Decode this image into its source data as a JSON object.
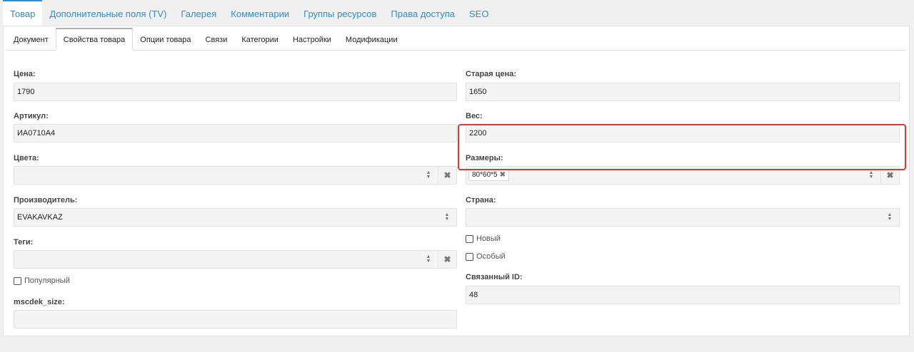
{
  "top_tabs": [
    "Товар",
    "Дополнительные поля (TV)",
    "Галерея",
    "Комментарии",
    "Группы ресурсов",
    "Права доступа",
    "SEO"
  ],
  "sub_tabs": [
    "Документ",
    "Свойства товара",
    "Опции товара",
    "Связи",
    "Категории",
    "Настройки",
    "Модификации"
  ],
  "left": {
    "price": {
      "label": "Цена:",
      "value": "1790"
    },
    "article": {
      "label": "Артикул:",
      "value": "ИА0710А4"
    },
    "colors": {
      "label": "Цвета:",
      "value": ""
    },
    "manufacturer": {
      "label": "Производитель:",
      "value": "EVAKAVKAZ"
    },
    "tags": {
      "label": "Теги:",
      "value": ""
    },
    "popular": {
      "label": "Популярный",
      "checked": false
    },
    "mscdek": {
      "label": "mscdek_size:",
      "value": ""
    }
  },
  "right": {
    "old_price": {
      "label": "Старая цена:",
      "value": "1650"
    },
    "weight": {
      "label": "Вес:",
      "value": "2200"
    },
    "sizes": {
      "label": "Размеры:",
      "tags": [
        "80*60*5"
      ]
    },
    "country": {
      "label": "Страна:",
      "value": ""
    },
    "new": {
      "label": "Новый",
      "checked": false
    },
    "special": {
      "label": "Особый",
      "checked": false
    },
    "linked_id": {
      "label": "Связанный ID:",
      "value": "48"
    }
  },
  "icons": {
    "clear": "✖",
    "tag_remove": "✖",
    "up": "▲",
    "down": "▼"
  },
  "colors": {
    "accent": "#2d8fd1",
    "highlight": "#d63a3a"
  }
}
